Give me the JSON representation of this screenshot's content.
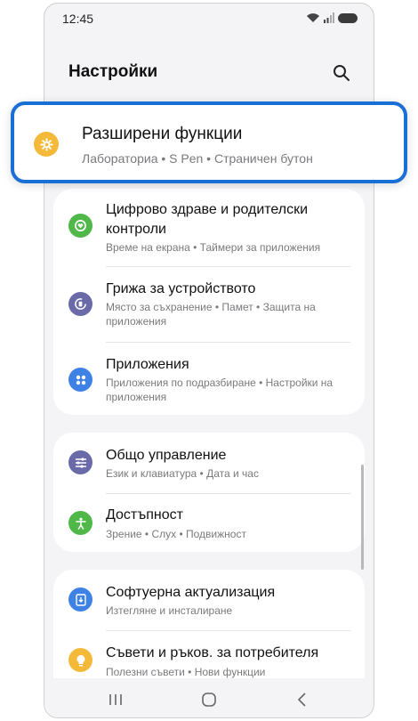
{
  "status_bar": {
    "time": "12:45"
  },
  "header": {
    "title": "Настройки"
  },
  "highlighted": {
    "title": "Разширени функции",
    "subtitle": "Лабораториа  •  S Pen  •  Страничен бутон"
  },
  "group1": [
    {
      "title": "Цифрово здраве и родителски контроли",
      "subtitle": "Време на екрана  •  Таймери за приложения",
      "icon": "digital-wellbeing-icon",
      "color": "#4fb848"
    },
    {
      "title": "Грижа за устройството",
      "subtitle": "Място за съхранение  •  Памет  •  Защита на приложения",
      "icon": "device-care-icon",
      "color": "#6a6aa8"
    },
    {
      "title": "Приложения",
      "subtitle": "Приложения по подразбиране  •  Настройки на приложения",
      "icon": "apps-icon",
      "color": "#3f82e6"
    }
  ],
  "group2": [
    {
      "title": "Общо управление",
      "subtitle": "Език и клавиатура  •  Дата и час",
      "icon": "sliders-icon",
      "color": "#6a6aa8"
    },
    {
      "title": "Достъпност",
      "subtitle": "Зрение  •  Слух  •  Подвижност",
      "icon": "accessibility-icon",
      "color": "#4fb848"
    }
  ],
  "group3": [
    {
      "title": "Софтуерна актуализация",
      "subtitle": "Изтегляне и инсталиране",
      "icon": "software-update-icon",
      "color": "#3f82e6"
    },
    {
      "title": "Съвети и ръков. за потребителя",
      "subtitle": "Полезни съвети  •  Нови функции",
      "icon": "tips-icon",
      "color": "#f5b93a"
    }
  ]
}
